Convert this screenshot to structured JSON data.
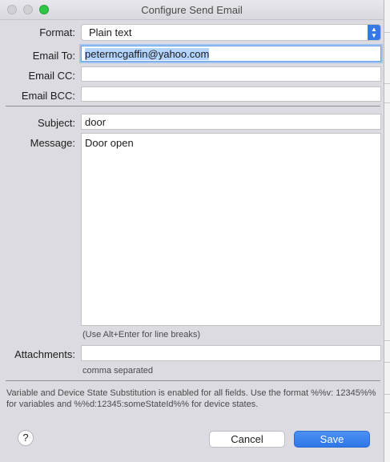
{
  "window": {
    "title": "Configure Send Email"
  },
  "form": {
    "format": {
      "label": "Format:",
      "value": "Plain text"
    },
    "email_to": {
      "label": "Email To:",
      "value": "petermcgaffin@yahoo.com"
    },
    "email_cc": {
      "label": "Email CC:",
      "value": ""
    },
    "email_bcc": {
      "label": "Email BCC:",
      "value": ""
    },
    "subject": {
      "label": "Subject:",
      "value": "door"
    },
    "message": {
      "label": "Message:",
      "value": "Door open",
      "hint": "(Use Alt+Enter for line breaks)"
    },
    "attachments": {
      "label": "Attachments:",
      "value": "",
      "hint": "comma separated"
    }
  },
  "note": "Variable and Device State Substitution is enabled for all fields. Use the format %%v: 12345%% for variables and %%d:12345:someStateId%% for device states.",
  "buttons": {
    "help": "?",
    "cancel": "Cancel",
    "save": "Save"
  },
  "colors": {
    "accent": "#3479e6",
    "focus_ring": "#9fc3f0",
    "selection": "#b3d4fc"
  }
}
